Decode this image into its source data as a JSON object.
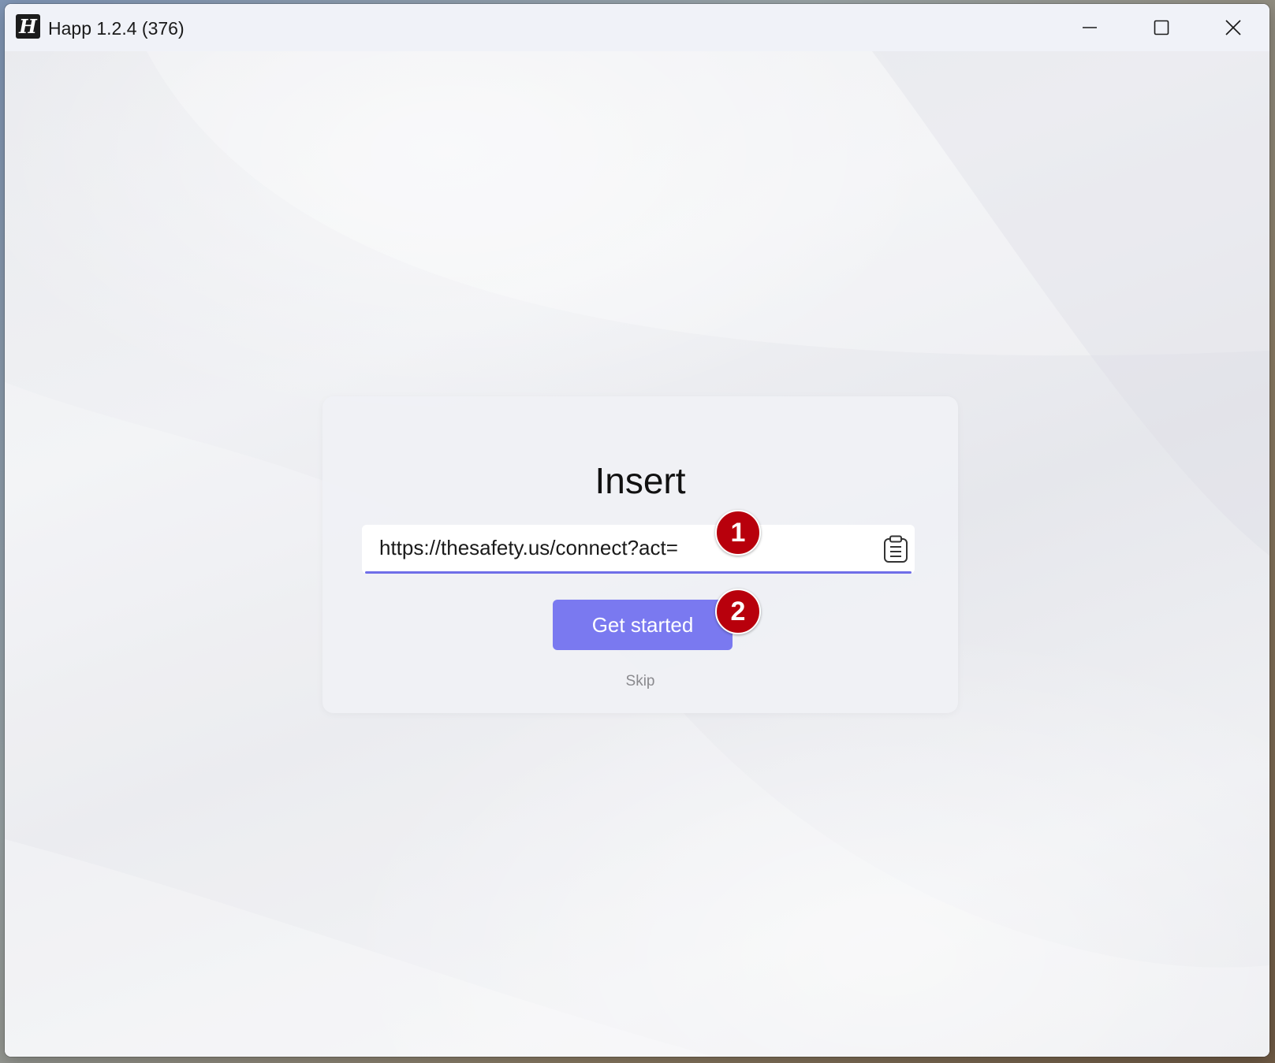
{
  "window": {
    "title": "Happ 1.2.4 (376)",
    "icon": "happ-logo-icon",
    "icon_glyph": "H",
    "controls": {
      "minimize": "minimize-icon",
      "maximize": "maximize-icon",
      "close": "close-icon"
    }
  },
  "dialog": {
    "title": "Insert",
    "url_input": {
      "value": "https://thesafety.us/connect?act=",
      "paste_icon": "clipboard-icon"
    },
    "primary_button": "Get started",
    "skip_link": "Skip"
  },
  "annotations": {
    "step1": "1",
    "step2": "2"
  },
  "colors": {
    "accent": "#7a79f0",
    "underline": "#6f6ee8",
    "marker": "#b8000c",
    "skip_text": "#8a8a8e"
  }
}
